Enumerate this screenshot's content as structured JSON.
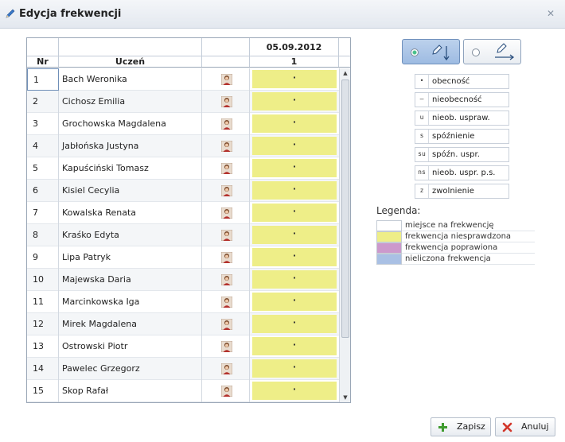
{
  "window": {
    "title": "Edycja frekwencji"
  },
  "grid": {
    "date": "05.09.2012",
    "col_nr": "Nr",
    "col_student": "Uczeń",
    "col_lesson": "1",
    "rows": [
      {
        "nr": "1",
        "name": "Bach Weronika",
        "mark": "·"
      },
      {
        "nr": "2",
        "name": "Cichosz Emilia",
        "mark": "·"
      },
      {
        "nr": "3",
        "name": "Grochowska Magdalena",
        "mark": "·"
      },
      {
        "nr": "4",
        "name": "Jabłońska Justyna",
        "mark": "·"
      },
      {
        "nr": "5",
        "name": "Kapuściński Tomasz",
        "mark": "·"
      },
      {
        "nr": "6",
        "name": "Kisiel Cecylia",
        "mark": "·"
      },
      {
        "nr": "7",
        "name": "Kowalska Renata",
        "mark": "·"
      },
      {
        "nr": "8",
        "name": "Kraśko Edyta",
        "mark": "·"
      },
      {
        "nr": "9",
        "name": "Lipa Patryk",
        "mark": "·"
      },
      {
        "nr": "10",
        "name": "Majewska Daria",
        "mark": "·"
      },
      {
        "nr": "11",
        "name": "Marcinkowska Iga",
        "mark": "·"
      },
      {
        "nr": "12",
        "name": "Mirek Magdalena",
        "mark": "·"
      },
      {
        "nr": "13",
        "name": "Ostrowski Piotr",
        "mark": "·"
      },
      {
        "nr": "14",
        "name": "Pawelec Grzegorz",
        "mark": "·"
      },
      {
        "nr": "15",
        "name": "Skop Rafał",
        "mark": "·"
      }
    ]
  },
  "mode": {
    "vertical_icon": "pencil-arrow-down-icon",
    "horizontal_icon": "pencil-arrow-right-icon",
    "selected": "vertical"
  },
  "codes": [
    {
      "sym": "•",
      "label": "obecność"
    },
    {
      "sym": "—",
      "label": "nieobecność"
    },
    {
      "sym": "u",
      "label": "nieob. uspraw."
    },
    {
      "sym": "s",
      "label": "spóźnienie"
    },
    {
      "sym": "su",
      "label": "spóźn. uspr."
    },
    {
      "sym": "ns",
      "label": "nieob. uspr. p.s."
    },
    {
      "sym": "z",
      "label": "zwolnienie"
    }
  ],
  "legend": {
    "title": "Legenda:",
    "items": [
      {
        "label": "miejsce na frekwencję",
        "color": "#ffffff"
      },
      {
        "label": "frekwencja niesprawdzona",
        "color": "#eeee88"
      },
      {
        "label": "frekwencja poprawiona",
        "color": "#cc99cc"
      },
      {
        "label": "nieliczona frekwencja",
        "color": "#a9c0e4"
      }
    ]
  },
  "buttons": {
    "save": "Zapisz",
    "cancel": "Anuluj"
  },
  "colors": {
    "unchecked": "#eeee88",
    "accent": "#9dbbe2"
  }
}
